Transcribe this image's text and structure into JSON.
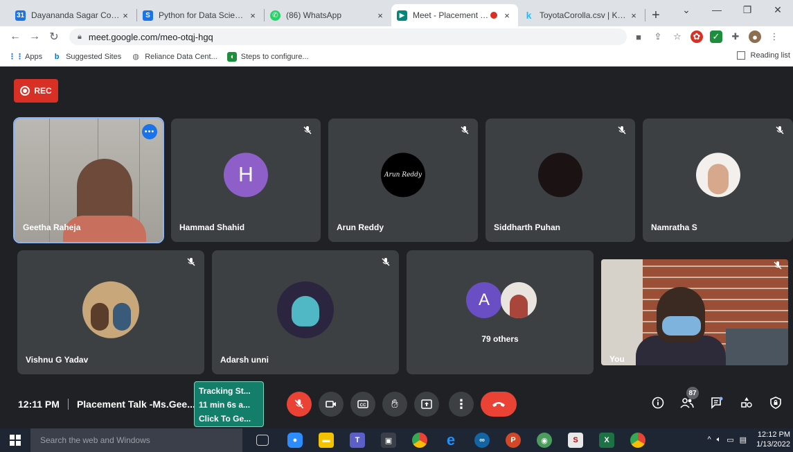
{
  "browser": {
    "tabs": [
      {
        "title": "Dayananda Sagar College",
        "close": "×",
        "icon": "calendar-icon",
        "color": "#1a73e8"
      },
      {
        "title": "Python for Data Science -",
        "close": "×",
        "icon": "s-logo-icon",
        "color": "#1a73e8"
      },
      {
        "title": "(86) WhatsApp",
        "close": "×",
        "icon": "whatsapp-icon",
        "color": "#25d366"
      },
      {
        "title": "Meet - Placement Tal",
        "close": "×",
        "icon": "meet-icon",
        "color": "#00897b",
        "active": true
      },
      {
        "title": "ToyotaCorolla.csv | Kaggle",
        "close": "×",
        "icon": "kaggle-icon",
        "color": "#20beff"
      }
    ],
    "new_tab": "+",
    "window_controls": [
      "⌄",
      "—",
      "❐",
      "✕"
    ],
    "url": "meet.google.com/meo-otqj-hgq",
    "bookmarks": [
      {
        "label": "Apps",
        "icon": "apps-grid-icon"
      },
      {
        "label": "Suggested Sites",
        "icon": "bing-icon"
      },
      {
        "label": "Reliance Data Cent...",
        "icon": "globe-icon"
      },
      {
        "label": "Steps to configure...",
        "icon": "bookmark-icon"
      }
    ],
    "reading_list": "Reading list"
  },
  "meet": {
    "rec_label": "REC",
    "participants": [
      {
        "name": "Geetha Raheja",
        "type": "video",
        "pinned": true
      },
      {
        "name": "Hammad Shahid",
        "initial": "H",
        "avatar_color": "#8e5fc9"
      },
      {
        "name": "Arun Reddy",
        "avatar_color": "#000000",
        "avatar_text": "Arun Reddy"
      },
      {
        "name": "Siddharth Puhan",
        "avatar_color": "#1b1213"
      },
      {
        "name": "Namratha S",
        "avatar_color": "#f2efec"
      },
      {
        "name": "Vishnu G Yadav",
        "avatar_color": "#c8a77a"
      },
      {
        "name": "Adarsh unni",
        "avatar_color": "#2b2540"
      },
      {
        "name": "You",
        "type": "video"
      }
    ],
    "others": {
      "initial": "A",
      "label": "79 others",
      "avatar_color": "#6a4fc4"
    },
    "clock": "12:11 PM",
    "meeting_title": "Placement Talk -Ms.Gee...",
    "tracking_lines": [
      "Tracking St...",
      "11 min 6s a...",
      "Click To Ge..."
    ],
    "participant_count": "87"
  },
  "taskbar": {
    "search_placeholder": "Search the web and Windows",
    "time": "12:12 PM",
    "date": "1/13/2022"
  }
}
